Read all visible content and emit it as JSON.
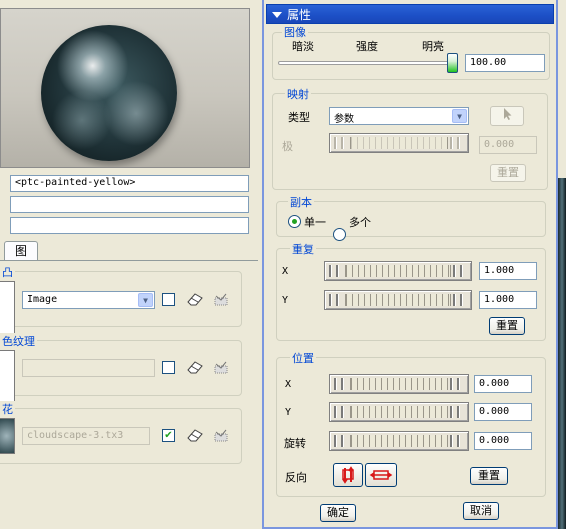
{
  "left": {
    "material_name": "<ptc-painted-yellow>",
    "field2": "",
    "field3": "",
    "tab_label": "图",
    "group1": {
      "title": "凸",
      "combo_value": "Image"
    },
    "group2": {
      "title": "色纹理",
      "combo_value": ""
    },
    "group3": {
      "title": "花",
      "combo_value": "cloudscape-3.tx3",
      "checked": true
    }
  },
  "panel": {
    "title": "属性",
    "image_section": {
      "title": "图像",
      "labels": [
        "暗淡",
        "强度",
        "明亮"
      ],
      "value": "100.00",
      "slider_fraction": 1.0
    },
    "mapping_section": {
      "title": "映射",
      "type_label": "类型",
      "type_value": "参数",
      "pole_label": "极",
      "pole_value": "0.000",
      "reset_label": "重置"
    },
    "copy_section": {
      "title": "副本",
      "single_label": "单一",
      "multi_label": "多个",
      "selected": "single"
    },
    "repeat_section": {
      "title": "重复",
      "x_label": "X",
      "x_value": "1.000",
      "y_label": "Y",
      "y_value": "1.000",
      "reset_label": "重置"
    },
    "position_section": {
      "title": "位置",
      "x_label": "X",
      "x_value": "0.000",
      "y_label": "Y",
      "y_value": "0.000",
      "rotate_label": "旋转",
      "rotate_value": "0.000",
      "flip_label": "反向",
      "reset_label": "重置"
    },
    "ok_label": "确定",
    "cancel_label": "取消"
  },
  "colors": {
    "title_bar": "#1c4fc6",
    "section_title": "#0046d5",
    "panel_bg": "#ece9d8",
    "flip_icon": "#d81818"
  }
}
